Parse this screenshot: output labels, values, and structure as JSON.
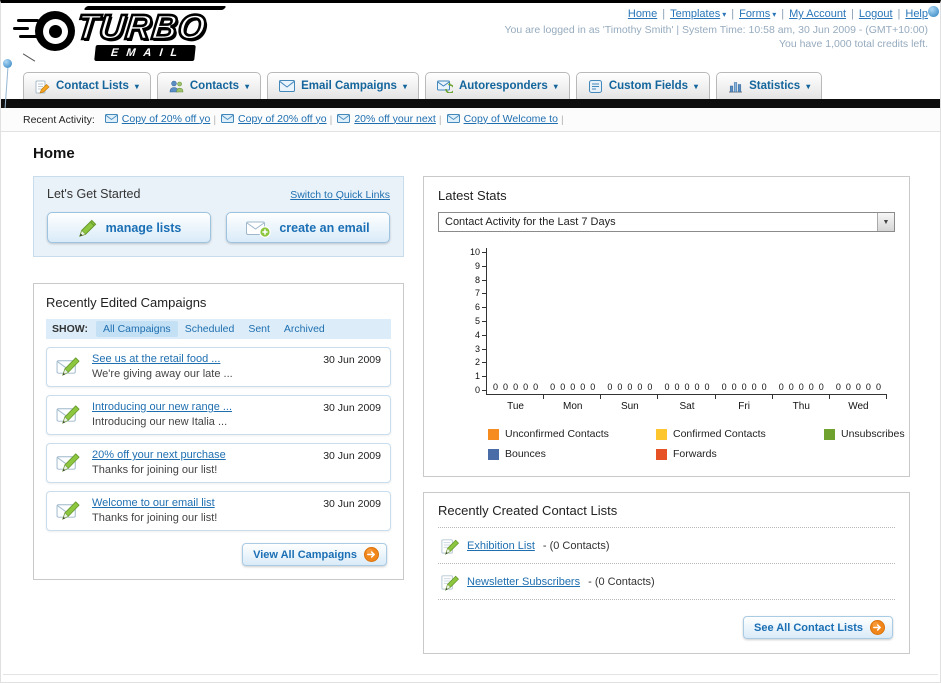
{
  "header": {
    "logo_line1": "TURBO",
    "logo_line2": "EMAIL",
    "top_links": [
      {
        "label": "Home",
        "dropdown": false
      },
      {
        "label": "Templates",
        "dropdown": true
      },
      {
        "label": "Forms",
        "dropdown": true
      },
      {
        "label": "My Account",
        "dropdown": false
      },
      {
        "label": "Logout",
        "dropdown": false
      },
      {
        "label": "Help",
        "dropdown": false
      }
    ],
    "login_status": "You are logged in as 'Timothy Smith' | System Time: 10:58 am, 30 Jun 2009 - (GMT+10:00)",
    "credits_note": "You have 1,000 total credits left."
  },
  "nav_tabs": [
    {
      "label": "Contact Lists",
      "icon": "contact-lists-icon"
    },
    {
      "label": "Contacts",
      "icon": "contacts-icon"
    },
    {
      "label": "Email Campaigns",
      "icon": "email-campaigns-icon"
    },
    {
      "label": "Autoresponders",
      "icon": "autoresponders-icon"
    },
    {
      "label": "Custom Fields",
      "icon": "custom-fields-icon"
    },
    {
      "label": "Statistics",
      "icon": "statistics-icon"
    }
  ],
  "recent_activity": {
    "label": "Recent Activity:",
    "items": [
      "Copy of 20% off yo",
      "Copy of 20% off yo",
      "20% off your next",
      "Copy of Welcome to"
    ]
  },
  "page_title": "Home",
  "get_started": {
    "title": "Let's Get Started",
    "switch_link": "Switch to Quick Links",
    "manage_lists_label": "manage lists",
    "create_email_label": "create an email"
  },
  "campaigns": {
    "title": "Recently Edited Campaigns",
    "show_label": "SHOW:",
    "filters": [
      "All Campaigns",
      "Scheduled",
      "Sent",
      "Archived"
    ],
    "active_filter": "All Campaigns",
    "items": [
      {
        "title": "See us at the retail food ...",
        "subtitle": "We're giving away our late ...",
        "date": "30 Jun 2009"
      },
      {
        "title": "Introducing our new range ...",
        "subtitle": "Introducing our new Italia ...",
        "date": "30 Jun 2009"
      },
      {
        "title": "20% off your next purchase",
        "subtitle": "Thanks for joining our list!",
        "date": "30 Jun 2009"
      },
      {
        "title": "Welcome to our email list",
        "subtitle": "Thanks for joining our list!",
        "date": "30 Jun 2009"
      }
    ],
    "view_all_label": "View All Campaigns"
  },
  "stats": {
    "title": "Latest Stats",
    "dropdown_value": "Contact Activity for the Last 7 Days"
  },
  "chart_data": {
    "type": "bar",
    "title": "Contact Activity for the Last 7 Days",
    "categories": [
      "Tue",
      "Mon",
      "Sun",
      "Sat",
      "Fri",
      "Thu",
      "Wed"
    ],
    "series": [
      {
        "name": "Unconfirmed Contacts",
        "color": "#f68b1f",
        "values": [
          0,
          0,
          0,
          0,
          0,
          0,
          0
        ]
      },
      {
        "name": "Confirmed Contacts",
        "color": "#fdc62f",
        "values": [
          0,
          0,
          0,
          0,
          0,
          0,
          0
        ]
      },
      {
        "name": "Unsubscribes",
        "color": "#6fa22e",
        "values": [
          0,
          0,
          0,
          0,
          0,
          0,
          0
        ]
      },
      {
        "name": "Bounces",
        "color": "#4a6da7",
        "values": [
          0,
          0,
          0,
          0,
          0,
          0,
          0
        ]
      },
      {
        "name": "Forwards",
        "color": "#e65125",
        "values": [
          0,
          0,
          0,
          0,
          0,
          0,
          0
        ]
      }
    ],
    "ylim": [
      0,
      10
    ],
    "ytick_step": 1,
    "grid": false,
    "legend_position": "bottom",
    "show_value_labels": true
  },
  "contact_lists": {
    "title": "Recently Created Contact Lists",
    "items": [
      {
        "name": "Exhibition List",
        "detail": "- (0 Contacts)"
      },
      {
        "name": "Newsletter Subscribers",
        "detail": "- (0 Contacts)"
      }
    ],
    "see_all_label": "See All Contact Lists"
  }
}
